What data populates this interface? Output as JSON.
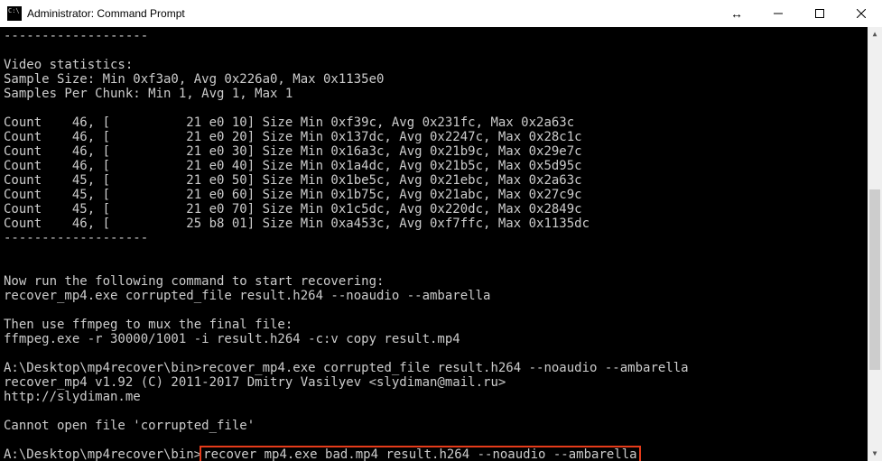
{
  "window": {
    "title": "Administrator: Command Prompt"
  },
  "term": {
    "sep": "-------------------",
    "stats_hdr": "Video statistics:",
    "sample_size": "Sample Size: Min 0xf3a0, Avg 0x226a0, Max 0x1135e0",
    "samples_per_chunk": "Samples Per Chunk: Min 1, Avg 1, Max 1",
    "counts": [
      "Count    46, [          21 e0 10] Size Min 0xf39c, Avg 0x231fc, Max 0x2a63c",
      "Count    46, [          21 e0 20] Size Min 0x137dc, Avg 0x2247c, Max 0x28c1c",
      "Count    46, [          21 e0 30] Size Min 0x16a3c, Avg 0x21b9c, Max 0x29e7c",
      "Count    46, [          21 e0 40] Size Min 0x1a4dc, Avg 0x21b5c, Max 0x5d95c",
      "Count    45, [          21 e0 50] Size Min 0x1be5c, Avg 0x21ebc, Max 0x2a63c",
      "Count    45, [          21 e0 60] Size Min 0x1b75c, Avg 0x21abc, Max 0x27c9c",
      "Count    45, [          21 e0 70] Size Min 0x1c5dc, Avg 0x220dc, Max 0x2849c",
      "Count    46, [          25 b8 01] Size Min 0xa453c, Avg 0xf7ffc, Max 0x1135dc"
    ],
    "instr1": "Now run the following command to start recovering:",
    "cmd1": "recover_mp4.exe corrupted_file result.h264 --noaudio --ambarella",
    "instr2": "Then use ffmpeg to mux the final file:",
    "cmd2": "ffmpeg.exe -r 30000/1001 -i result.h264 -c:v copy result.mp4",
    "prompt": "A:\\Desktop\\mp4recover\\bin>",
    "run_cmd": "recover_mp4.exe corrupted_file result.h264 --noaudio --ambarella",
    "version": "recover_mp4 v1.92 (C) 2011-2017 Dmitry Vasilyev <slydiman@mail.ru>",
    "url": "http://slydiman.me",
    "error": "Cannot open file 'corrupted_file'",
    "typed_cmd": "recover_mp4.exe bad.mp4 result.h264 --noaudio --ambarella"
  }
}
